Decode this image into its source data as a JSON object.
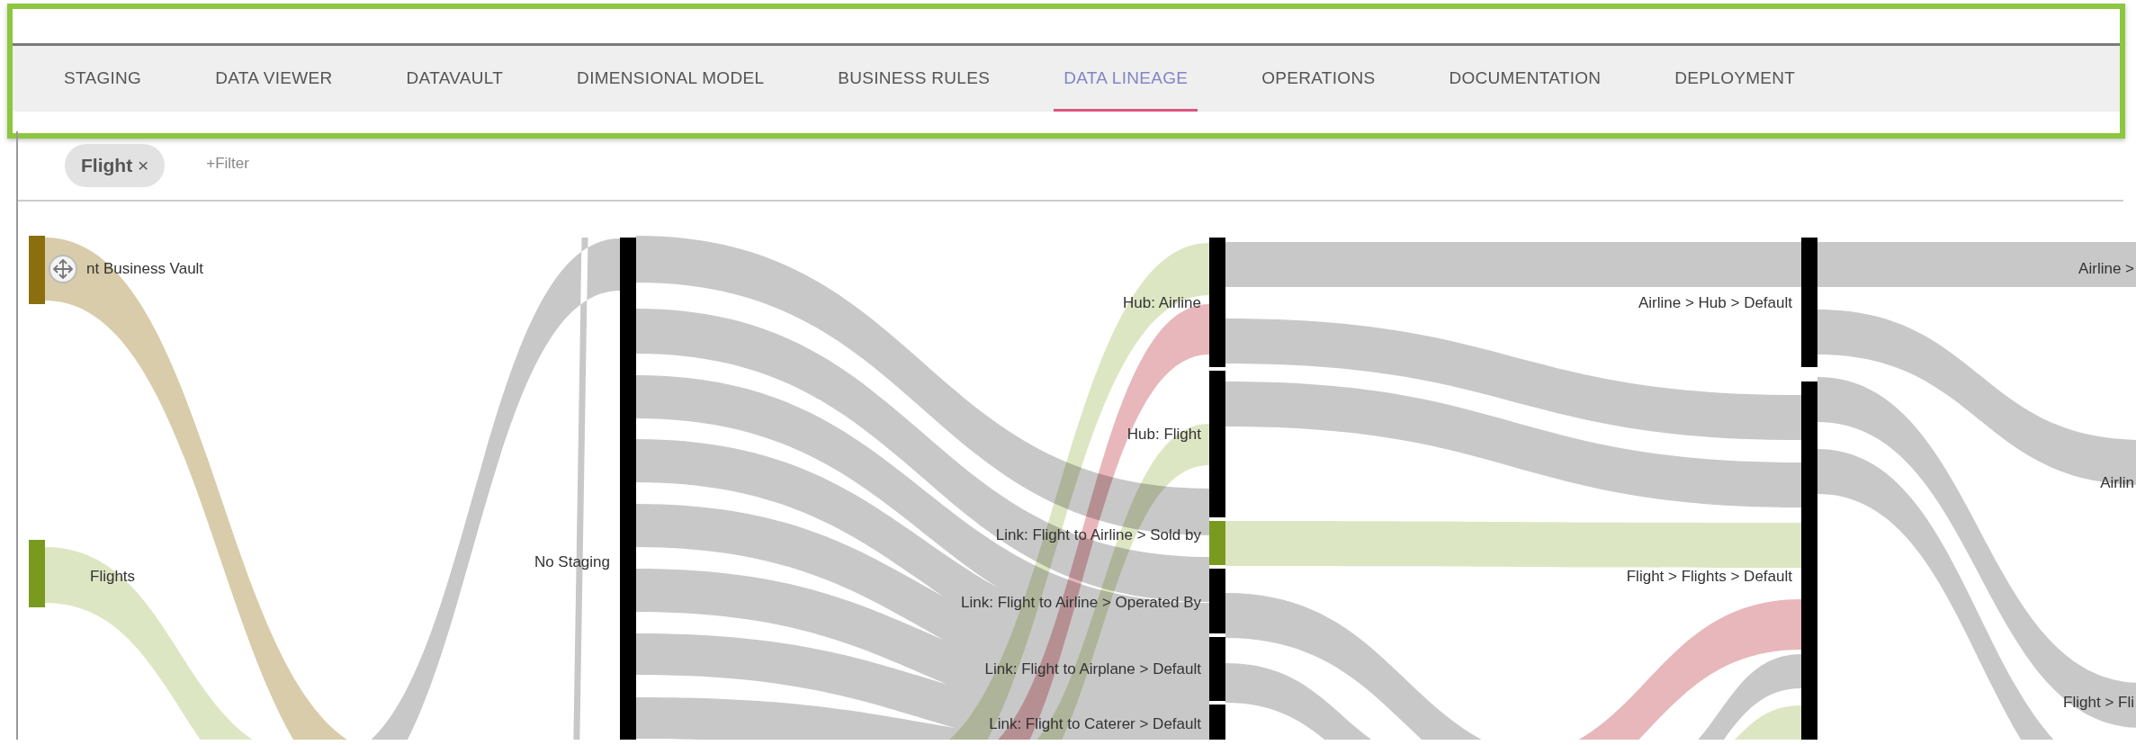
{
  "tabs": [
    {
      "label": "STAGING",
      "selected": false
    },
    {
      "label": "DATA VIEWER",
      "selected": false
    },
    {
      "label": "DATAVAULT",
      "selected": false
    },
    {
      "label": "DIMENSIONAL MODEL",
      "selected": false
    },
    {
      "label": "BUSINESS RULES",
      "selected": false
    },
    {
      "label": "DATA LINEAGE",
      "selected": true
    },
    {
      "label": "OPERATIONS",
      "selected": false
    },
    {
      "label": "DOCUMENTATION",
      "selected": false
    },
    {
      "label": "DEPLOYMENT",
      "selected": false
    }
  ],
  "filter_bar": {
    "chips": [
      {
        "label": "Flight",
        "remove": "×"
      }
    ],
    "add_filter": "+Filter"
  },
  "sankey": {
    "nodes": [
      {
        "label": "nt Business Vault",
        "color": "#8b6f0e"
      },
      {
        "label": "Flights",
        "color": "#7a9a1f"
      },
      {
        "label": "No Staging",
        "color": "#000000"
      },
      {
        "label": "Hub: Airline",
        "color": "#000000"
      },
      {
        "label": "Hub: Flight",
        "color": "#000000"
      },
      {
        "label": "Link: Flight to Airline > Sold by",
        "color": "#7a9a1f"
      },
      {
        "label": "Link: Flight to Airline > Operated By",
        "color": "#000000"
      },
      {
        "label": "Link: Flight to Airplane > Default",
        "color": "#000000"
      },
      {
        "label": "Link: Flight to Caterer > Default",
        "color": "#000000"
      },
      {
        "label": "Airline > Hub > Default",
        "color": "#000000"
      },
      {
        "label": "Flight > Flights > Default",
        "color": "#000000"
      },
      {
        "label": "Airline >"
      },
      {
        "label": "Airlin"
      },
      {
        "label": "Flight > Fli"
      }
    ],
    "flow_groups": [
      {
        "color": "#d8ccaa"
      },
      {
        "color": "#c8c8c8"
      },
      {
        "color": "#dde6c3"
      },
      {
        "color": "#e8b7bb"
      }
    ]
  }
}
